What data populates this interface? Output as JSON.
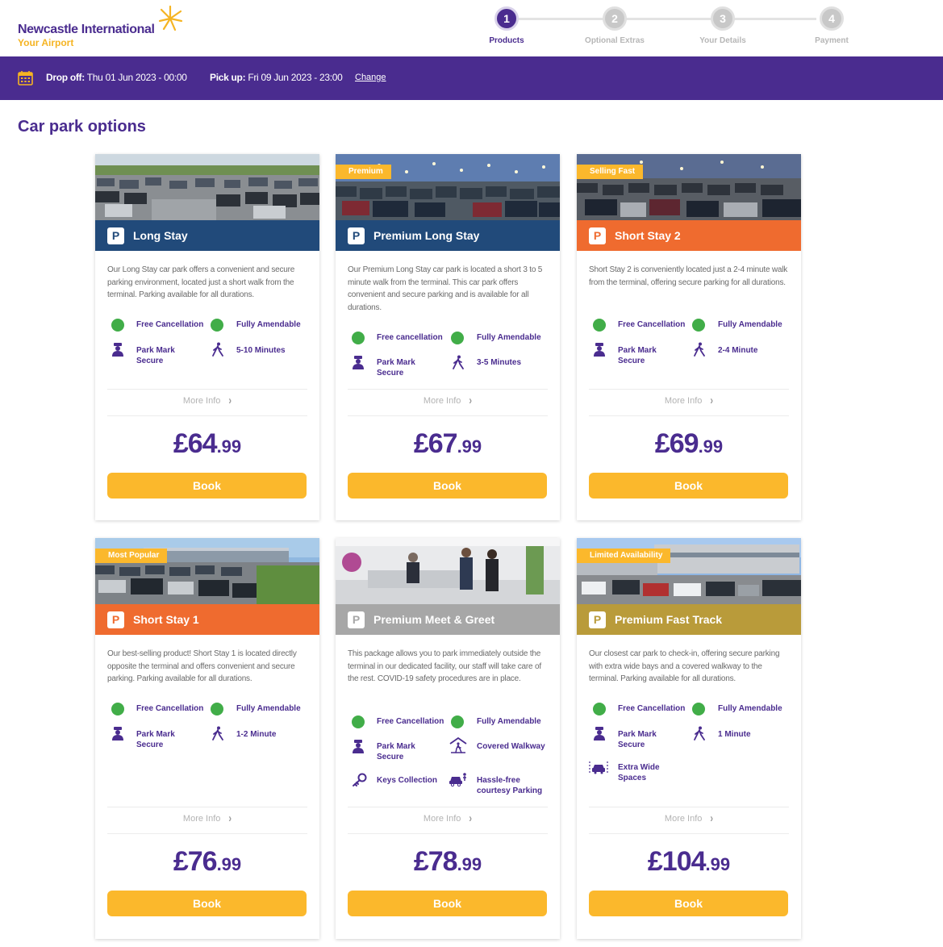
{
  "brand": {
    "name": "Newcastle International",
    "tagline": "Your Airport"
  },
  "steps": [
    {
      "number": "1",
      "label": "Products"
    },
    {
      "number": "2",
      "label": "Optional Extras"
    },
    {
      "number": "3",
      "label": "Your Details"
    },
    {
      "number": "4",
      "label": "Payment"
    }
  ],
  "booking": {
    "dropoff_label": "Drop off:",
    "dropoff_value": "Thu 01 Jun 2023 - 00:00",
    "pickup_label": "Pick up:",
    "pickup_value": "Fri 09 Jun 2023 - 23:00",
    "change_label": "Change"
  },
  "page_title": "Car park options",
  "more_info_label": "More Info",
  "book_label": "Book",
  "colors": {
    "purple": "#4a2c8f",
    "yellow": "#fbb82c",
    "navy": "#214a7a",
    "orange": "#ef6b2f",
    "grey": "#a7a7a7",
    "gold": "#b99b3a",
    "green": "#41ad48"
  },
  "cards": [
    {
      "name": "Long Stay",
      "badge": "",
      "desc": "Our Long Stay car park offers a convenient and secure parking environment, located just a short walk from the terminal. Parking available for all durations.",
      "features": [
        "Free Cancellation",
        "Fully Amendable",
        "Park Mark Secure",
        "5-10 Minutes"
      ],
      "price_major": "£64",
      "price_minor": ".99"
    },
    {
      "name": "Premium Long Stay",
      "badge": "Premium",
      "desc": "Our Premium Long Stay car park is located a short 3 to 5 minute walk from the terminal. This car park offers convenient and secure parking and is available for all durations.",
      "features": [
        "Free cancellation",
        "Fully Amendable",
        "Park Mark Secure",
        "3-5 Minutes"
      ],
      "price_major": "£67",
      "price_minor": ".99"
    },
    {
      "name": "Short Stay 2",
      "badge": "Selling Fast",
      "desc": "Short Stay 2 is conveniently located just a 2-4 minute walk from the terminal, offering secure parking for all durations.",
      "features": [
        "Free Cancellation",
        "Fully Amendable",
        "Park Mark Secure",
        "2-4 Minute"
      ],
      "price_major": "£69",
      "price_minor": ".99"
    },
    {
      "name": "Short Stay 1",
      "badge": "Most Popular",
      "desc": "Our best-selling product! Short Stay 1 is located directly opposite the terminal and offers convenient and secure parking. Parking available for all durations.",
      "features": [
        "Free Cancellation",
        "Fully Amendable",
        "Park Mark Secure",
        "1-2 Minute"
      ],
      "price_major": "£76",
      "price_minor": ".99"
    },
    {
      "name": "Premium Meet & Greet",
      "badge": "",
      "desc": "This package allows you to park immediately outside the terminal in our dedicated facility, our staff will take care of the rest. COVID-19 safety procedures are in place.",
      "features": [
        "Free Cancellation",
        "Fully Amendable",
        "Park Mark Secure",
        "Covered Walkway",
        "Keys Collection",
        "Hassle-free courtesy Parking"
      ],
      "price_major": "£78",
      "price_minor": ".99"
    },
    {
      "name": "Premium Fast Track",
      "badge": "Limited Availability",
      "desc": "Our closest car park to check-in, offering secure parking with extra wide bays and a covered walkway to the terminal. Parking available for all durations.",
      "features": [
        "Free Cancellation",
        "Fully Amendable",
        "Park Mark Secure",
        "1 Minute",
        "Extra Wide Spaces"
      ],
      "price_major": "£104",
      "price_minor": ".99"
    }
  ]
}
